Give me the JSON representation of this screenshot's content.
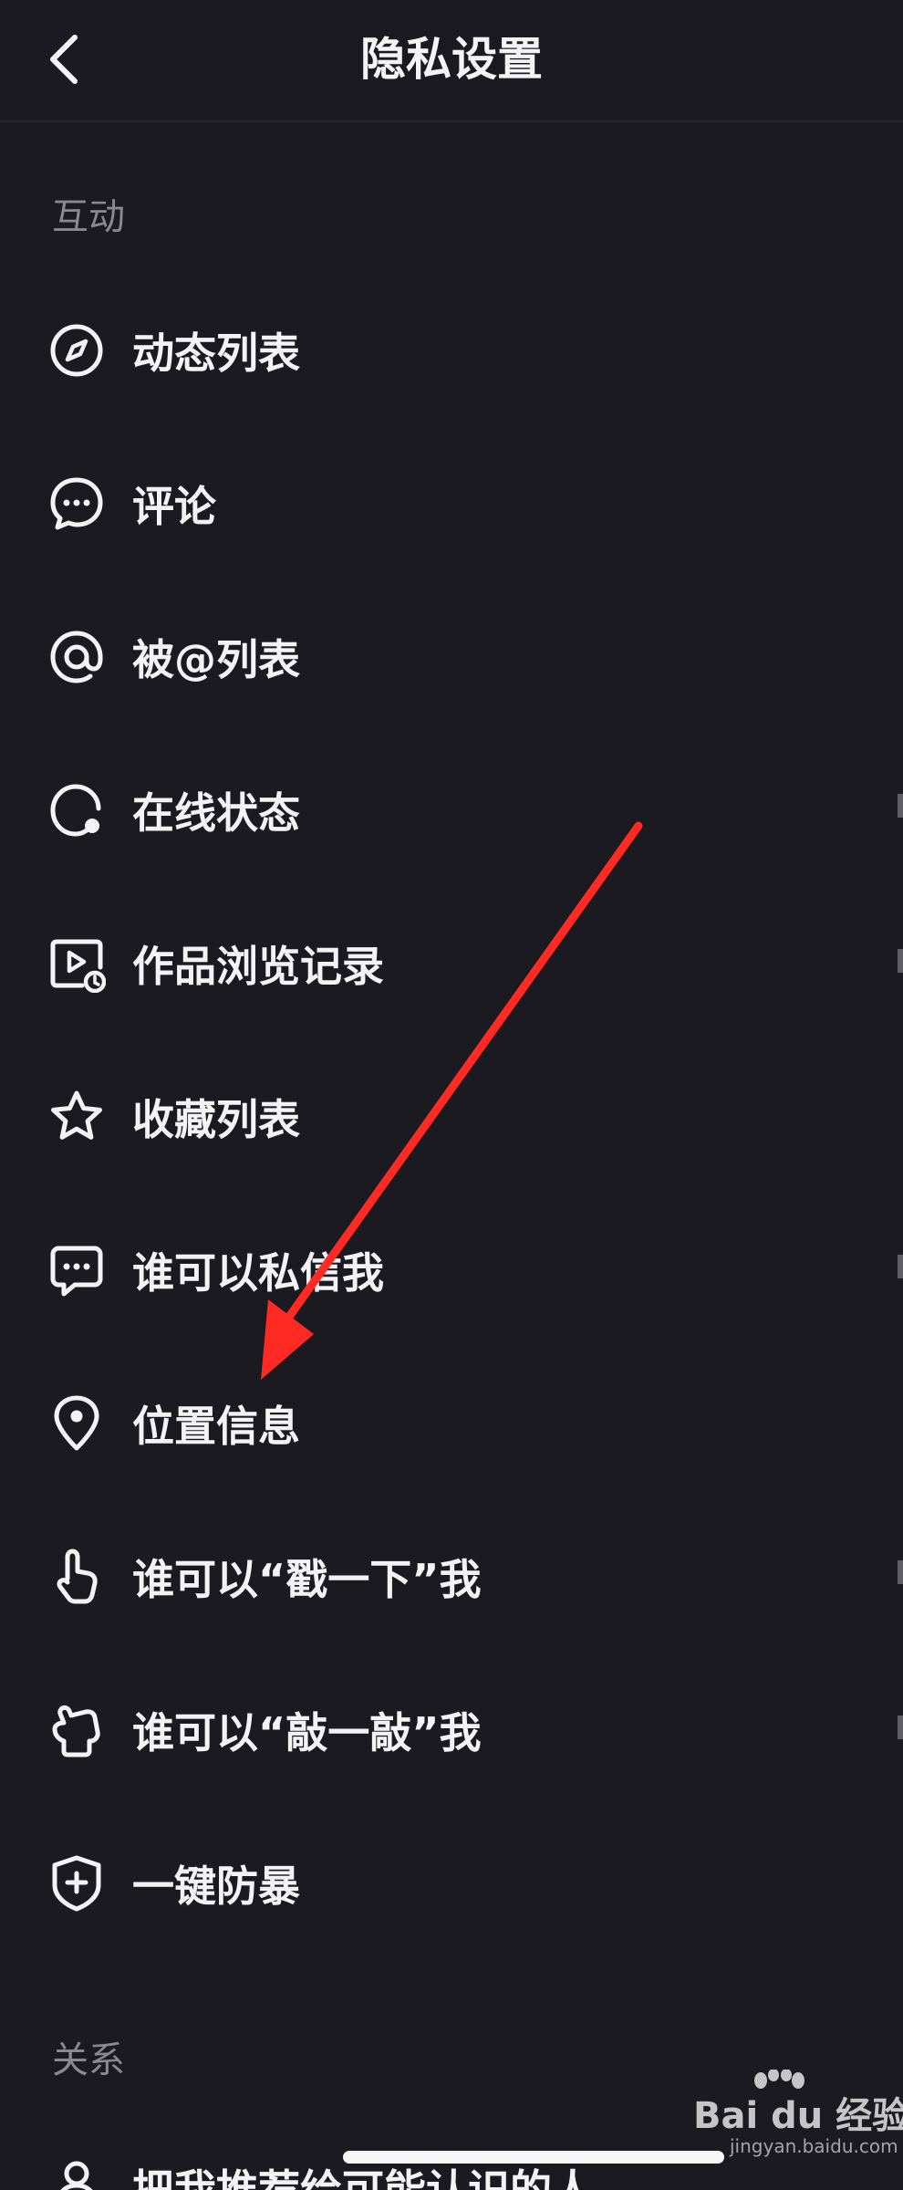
{
  "header": {
    "title": "隐私设置"
  },
  "sections": [
    {
      "label": "互动"
    },
    {
      "label": "关系"
    }
  ],
  "items": [
    {
      "label": "动态列表",
      "icon": "compass-icon"
    },
    {
      "label": "评论",
      "icon": "comment-icon"
    },
    {
      "label": "被@列表",
      "icon": "at-icon"
    },
    {
      "label": "在线状态",
      "icon": "online-status-icon"
    },
    {
      "label": "作品浏览记录",
      "icon": "video-history-icon"
    },
    {
      "label": "收藏列表",
      "icon": "star-icon"
    },
    {
      "label": "谁可以私信我",
      "icon": "message-icon"
    },
    {
      "label": "位置信息",
      "icon": "location-pin-icon"
    },
    {
      "label": "谁可以“戳一下”我",
      "icon": "poke-hand-icon"
    },
    {
      "label": "谁可以“敲一敲”我",
      "icon": "knock-hand-icon"
    },
    {
      "label": "一键防暴",
      "icon": "shield-plus-icon"
    }
  ],
  "partial_item": {
    "label": "把我推荐给可能认识的人",
    "icon": "person-icon"
  },
  "watermark": {
    "text": "Bai du 经验",
    "sub": "jingyan.baidu.com"
  },
  "colors": {
    "background": "#1b1a20",
    "text": "#f3f3f5",
    "muted": "#8a8990",
    "arrow": "#ff2a24"
  }
}
